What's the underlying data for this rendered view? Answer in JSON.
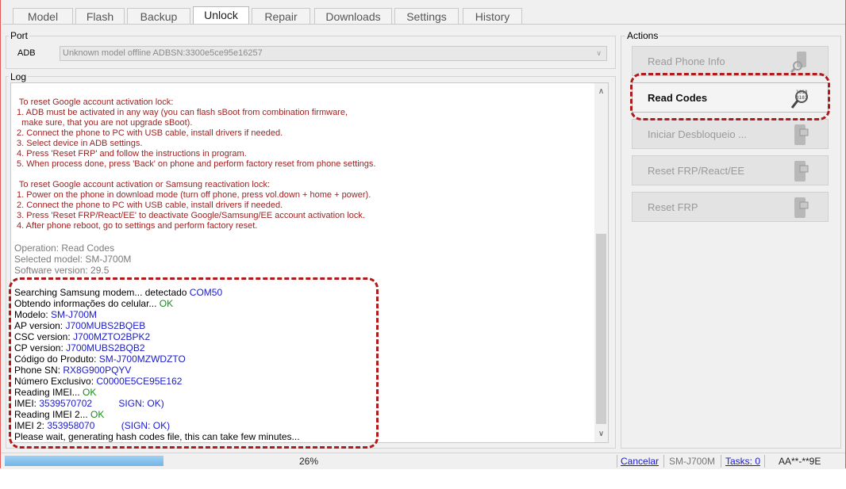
{
  "tabs": [
    {
      "label": "Model"
    },
    {
      "label": "Flash"
    },
    {
      "label": "Backup"
    },
    {
      "label": "Unlock",
      "active": true
    },
    {
      "label": "Repair"
    },
    {
      "label": "Downloads"
    },
    {
      "label": "Settings"
    },
    {
      "label": "History"
    }
  ],
  "port": {
    "title": "Port",
    "label": "ADB",
    "value": "Unknown model offline ADBSN:3300e5ce95e16257"
  },
  "log": {
    "title": "Log",
    "instructions": [
      "  To reset Google account activation lock:",
      " 1. ADB must be activated in any way (you can flash sBoot from combination firmware,",
      "   make sure, that you are not upgrade sBoot).",
      " 2. Connect the phone to PC with USB cable, install drivers if needed.",
      " 3. Select device in ADB settings.",
      " 4. Press 'Reset FRP' and follow the instructions in program.",
      " 5. When process done, press 'Back' on phone and perform factory reset from phone settings.",
      "",
      "  To reset Google account activation or Samsung reactivation lock:",
      " 1. Power on the phone in download mode (turn off phone, press vol.down + home + power).",
      " 2. Connect the phone to PC with USB cable, install drivers if needed.",
      " 3. Press 'Reset FRP/React/EE' to deactivate Google/Samsung/EE account activation lock.",
      " 4. After phone reboot, go to settings and perform factory reset."
    ],
    "info": [
      "Operation: Read Codes",
      "Selected model: SM-J700M",
      "Software version: 29.5"
    ],
    "entries": [
      {
        "label": "Searching Samsung modem... detectado ",
        "value": "COM50",
        "color": "blue"
      },
      {
        "label": "Obtendo informações do celular... ",
        "value": "OK",
        "color": "green"
      },
      {
        "label": "Modelo: ",
        "value": "SM-J700M",
        "color": "blue"
      },
      {
        "label": "AP version: ",
        "value": "J700MUBS2BQEB",
        "color": "blue"
      },
      {
        "label": "CSC version: ",
        "value": "J700MZTO2BPK2",
        "color": "blue"
      },
      {
        "label": "CP version: ",
        "value": "J700MUBS2BQB2",
        "color": "blue"
      },
      {
        "label": "Código do Produto: ",
        "value": "SM-J700MZWDZTO",
        "color": "blue"
      },
      {
        "label": "Phone SN: ",
        "value": "RX8G900PQYV",
        "color": "blue"
      },
      {
        "label": "Número Exclusivo: ",
        "value": "C0000E5CE95E162",
        "color": "blue"
      },
      {
        "label": "Reading IMEI... ",
        "value": "OK",
        "color": "green"
      },
      {
        "label": "IMEI: ",
        "value": "3539570702          SIGN: OK)",
        "color": "blue"
      },
      {
        "label": "Reading IMEI 2... ",
        "value": "OK",
        "color": "green"
      },
      {
        "label": "IMEI 2: ",
        "value": "353958070          (SIGN: OK)",
        "color": "blue"
      },
      {
        "label": "Please wait, generating hash codes file, this can take few minutes...",
        "value": "",
        "color": "blue"
      }
    ]
  },
  "actions": {
    "title": "Actions",
    "buttons": [
      {
        "label": "Read Phone Info",
        "icon": "phone-search-icon",
        "enabled": false
      },
      {
        "label": "Read Codes",
        "icon": "magnifier-binary-icon",
        "enabled": true
      },
      {
        "label": "Iniciar Desbloqueio ...",
        "icon": "phone-lock-icon",
        "enabled": false
      },
      {
        "label": "Reset FRP/React/EE",
        "icon": "phone-lock-icon",
        "enabled": false
      },
      {
        "label": "Reset FRP",
        "icon": "phone-lock-icon",
        "enabled": false
      }
    ]
  },
  "status": {
    "progress": 0.26,
    "progress_text": "26%",
    "cancel": "Cancelar",
    "model": "SM-J700M",
    "tasks": "Tasks: 0",
    "code": "AA**-**9E"
  },
  "colors": {
    "highlight": "#b11a1a",
    "instructions": "#a02222",
    "value_blue": "#1a1acc",
    "ok_green": "#1a8a1a"
  }
}
